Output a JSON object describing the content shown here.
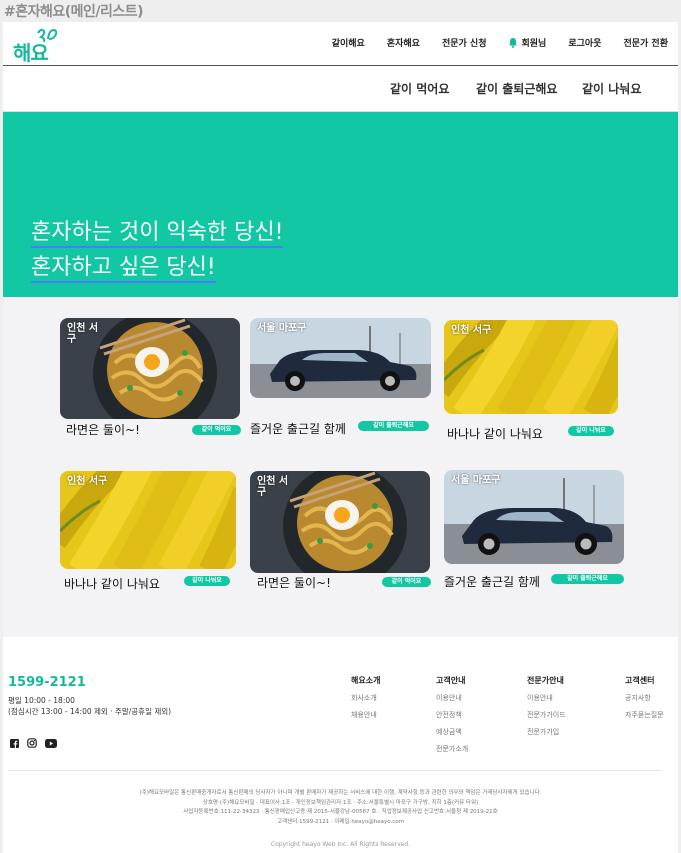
{
  "frame_title": "#혼자해요(메인/리스트)",
  "logo": {
    "text": "해요"
  },
  "top_nav": [
    "같이해요",
    "혼자해요",
    "전문가 신청",
    "회원님",
    "로그아웃",
    "전문가 전환"
  ],
  "sub_nav": [
    "같이 먹어요",
    "같이 출퇴근해요",
    "같이 나눠요"
  ],
  "hero": {
    "line1": "혼자하는 것이 익숙한 당신!",
    "line2": "혼자하고 싶은 당신!"
  },
  "cards": [
    {
      "location": "인천 서\n구",
      "title": "라면은 둘이~!",
      "tag": "같이 먹어요",
      "image": "ramen"
    },
    {
      "location": "서울 마포구",
      "title": "즐거운 출근길 함께",
      "tag": "같이 출퇴근해요",
      "image": "car"
    },
    {
      "location": "인천 서구",
      "title": "바나나 같이 나눠요",
      "tag": "같이 나눠요",
      "image": "banana"
    },
    {
      "location": "인천 서구",
      "title": "바나나 같이 나눠요",
      "tag": "같이 나눠요",
      "image": "banana"
    },
    {
      "location": "인천 서\n구",
      "title": "라면은 둘이~!",
      "tag": "같이 먹어요",
      "image": "ramen"
    },
    {
      "location": "서울 마포구",
      "title": "즐거운 출근길 함께",
      "tag": "같이 출퇴근해요",
      "image": "car"
    }
  ],
  "footer": {
    "phone": "1599-2121",
    "hours": "평일 10:00 - 18:00",
    "hours_note": "(점심시간 13:00 - 14:00 제외 · 주말/공휴일 제외)",
    "social_icons": [
      "facebook-icon",
      "instagram-icon",
      "youtube-icon"
    ],
    "columns": [
      {
        "head": "해요소개",
        "items": [
          "회사소개",
          "채용안내"
        ]
      },
      {
        "head": "고객안내",
        "items": [
          "이용안내",
          "안전정책",
          "예상금액",
          "전문가소개"
        ]
      },
      {
        "head": "전문가안내",
        "items": [
          "이용안내",
          "전문가가이드",
          "전문가가입"
        ]
      },
      {
        "head": "고객센터",
        "items": [
          "공지사항",
          "자주묻는질문"
        ]
      }
    ],
    "legal": [
      "(주)해요모바일은 통신판매중개자로서 통신판매의 당사자가 아니며 개별 판매자가 제공하는 서비스에 대한 이행, 계약사항 등과 관련한 의무와 책임은 거래당사자에게 있습니다.",
      "상호명:(주)해요모바일 · 대표이사:1조 · 개인정보책임관리자:1조 · 주소:서울특별시 마포구 가구방, 지하 1층(커뮤 타워)",
      "사업자등록번호:111-22-34323 · 통신판매업신고증:제 2015-서울강남-00567 호 · 직업정보제공사업 신고번호:서울청 제 2019-21호",
      "고객센터:1599-2121 · 이메일:heayo@heayo.com"
    ],
    "copyright": "Copyright heayo Web Inc. All Rights Reserved."
  },
  "colors": {
    "brand": "#14b99b",
    "hero_bg": "#12c7a3",
    "tag_bg": "#12c7a3"
  }
}
